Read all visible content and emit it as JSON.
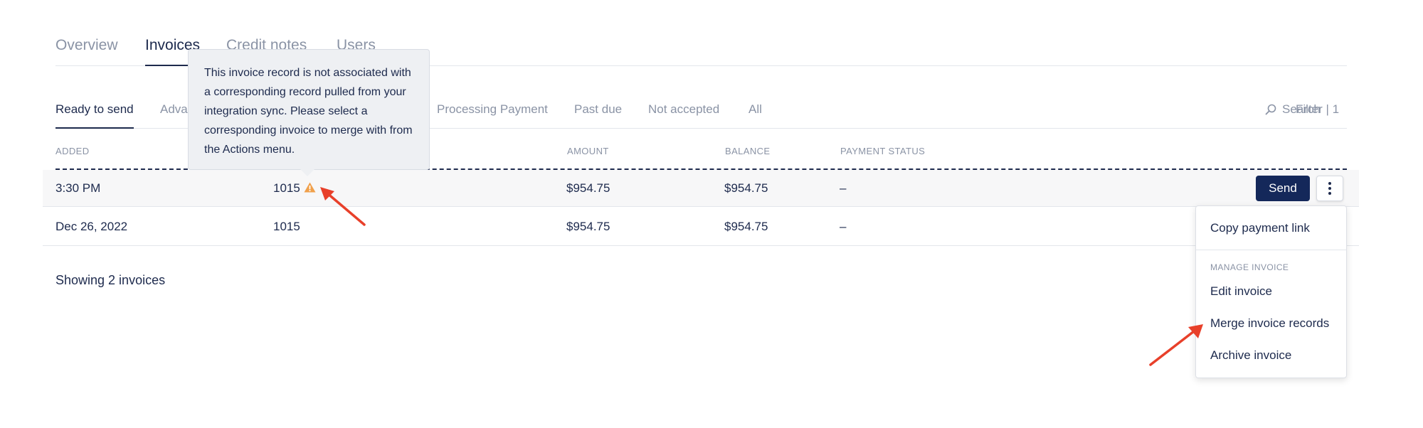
{
  "top_tabs": [
    "Overview",
    "Invoices",
    "Credit notes",
    "Users"
  ],
  "sub_tabs": [
    "Ready to send",
    "Advan",
    "Processing Payment",
    "Past due",
    "Not accepted",
    "All"
  ],
  "search_label": "Search",
  "filter_label": "Filter | 1",
  "columns": {
    "added": "ADDED",
    "amount": "AMOUNT",
    "balance": "BALANCE",
    "payment_status": "PAYMENT STATUS"
  },
  "rows": [
    {
      "added": "3:30 PM",
      "number": "1015",
      "amount": "$954.75",
      "balance": "$954.75",
      "status": "–"
    },
    {
      "added": "Dec 26, 2022",
      "number": "1015",
      "amount": "$954.75",
      "balance": "$954.75",
      "status": "–"
    }
  ],
  "send_label": "Send",
  "footer": "Showing 2 invoices",
  "tooltip": "This invoice record is not associated with a corresponding record pulled from your integration sync. Please select a corresponding invoice to merge with from the Actions menu.",
  "menu": {
    "copy_link": "Copy payment link",
    "section": "MANAGE INVOICE",
    "edit": "Edit invoice",
    "merge": "Merge invoice records",
    "archive": "Archive invoice"
  },
  "colors": {
    "primary": "#14285a",
    "text": "#1d2a4d",
    "muted": "#8a93a5",
    "warning": "#f0a04b",
    "annotation": "#e8402a"
  }
}
